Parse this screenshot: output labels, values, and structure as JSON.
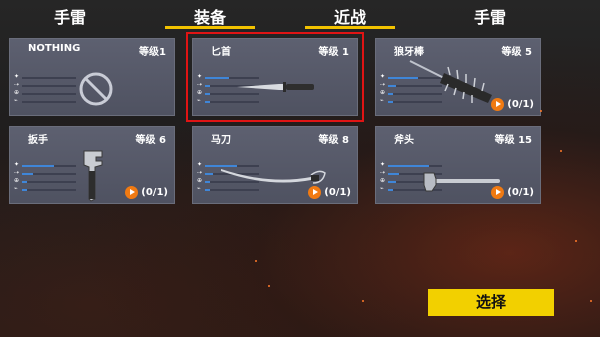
{
  "tabs": [
    {
      "label": "手雷"
    },
    {
      "label": "装备"
    },
    {
      "label": "近战"
    },
    {
      "label": "手雷"
    }
  ],
  "items": [
    {
      "name": "NOTHING",
      "level": "等级1",
      "ad": "",
      "weapon": "none-icon"
    },
    {
      "name": "匕首",
      "level": "等级 1",
      "ad": "",
      "weapon": "dagger-icon"
    },
    {
      "name": "狼牙棒",
      "level": "等级 5",
      "ad": "(0/1)",
      "weapon": "spiked-club-icon"
    },
    {
      "name": "扳手",
      "level": "等级 6",
      "ad": "(0/1)",
      "weapon": "wrench-icon"
    },
    {
      "name": "马刀",
      "level": "等级 8",
      "ad": "(0/1)",
      "weapon": "saber-icon"
    },
    {
      "name": "斧头",
      "level": "等级 15",
      "ad": "(0/1)",
      "weapon": "axe-icon"
    }
  ],
  "stat_levels": [
    [
      0,
      0,
      0,
      0
    ],
    [
      0.45,
      0.1,
      0.1,
      0.1
    ],
    [
      0.55,
      0.15,
      0.1,
      0.1
    ],
    [
      0.6,
      0.2,
      0.1,
      0.1
    ],
    [
      0.6,
      0.15,
      0.1,
      0.1
    ],
    [
      0.75,
      0.2,
      0.15,
      0.1
    ]
  ],
  "select_label": "选择",
  "colors": {
    "accent": "#f2c200",
    "selection": "#e01414",
    "stat_bar": "#3f86d8",
    "ad_icon": "#f07a12"
  }
}
